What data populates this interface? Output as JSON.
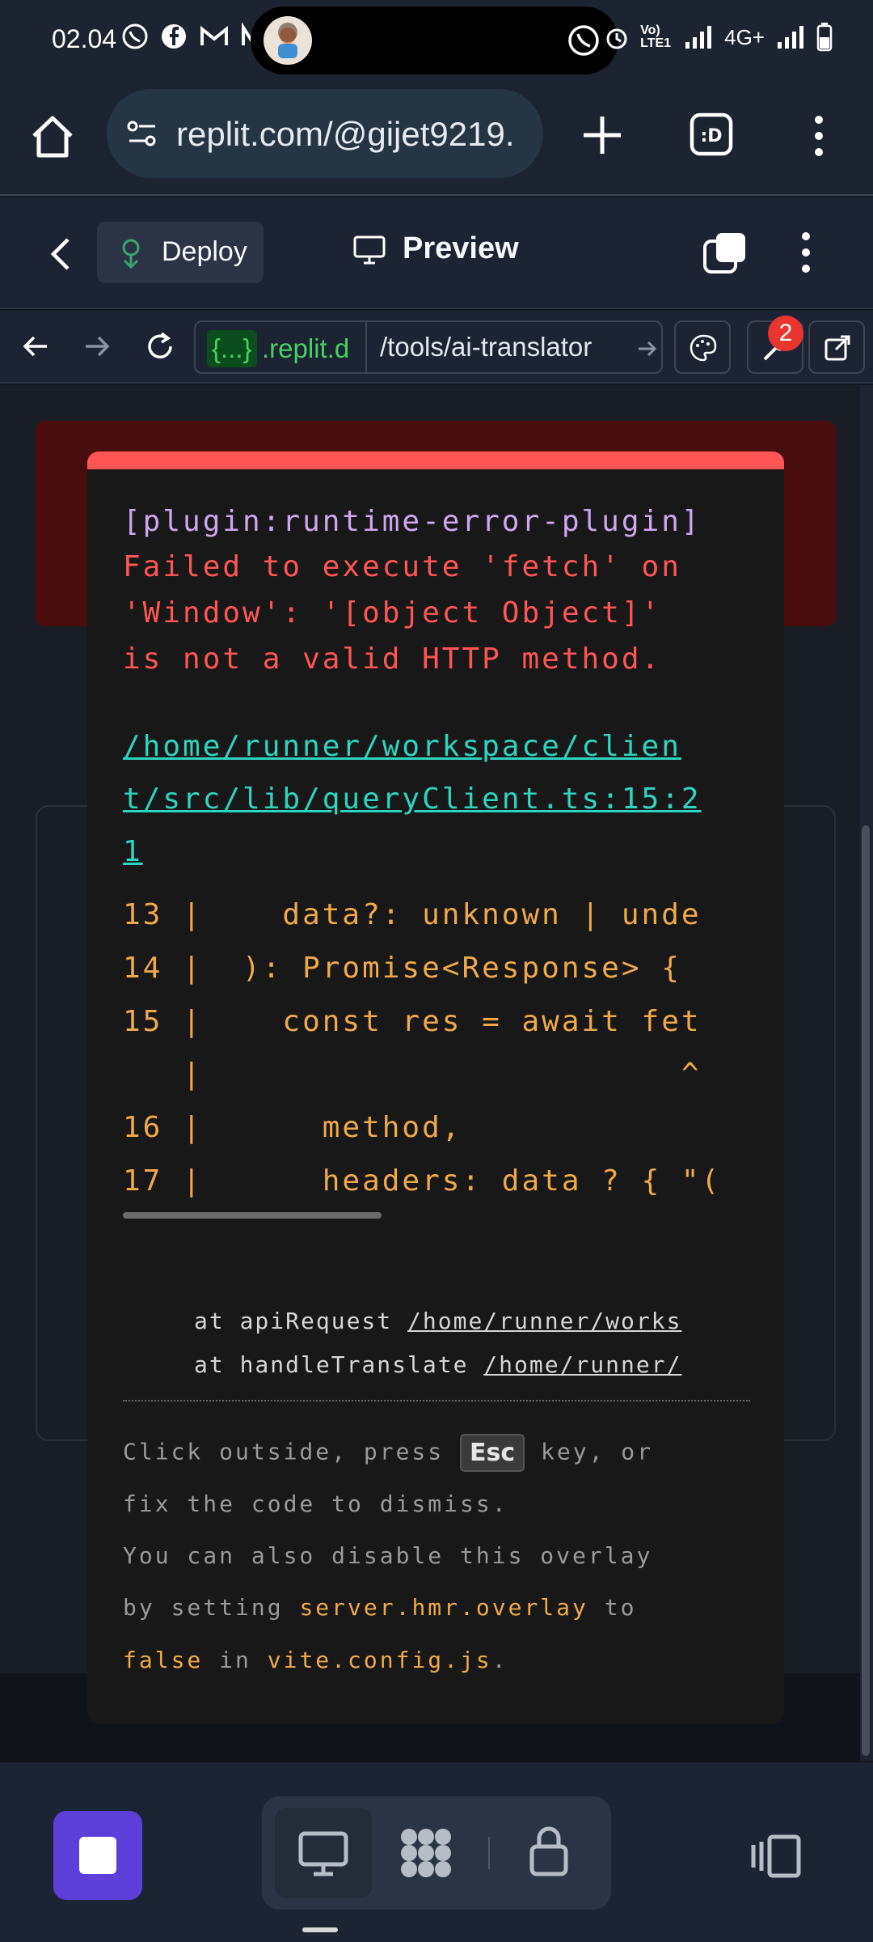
{
  "status_bar": {
    "time": "02.04",
    "network": "4G+",
    "volte": "Vo) LTE1"
  },
  "browser": {
    "url": "replit.com/@gijet9219."
  },
  "replit_header": {
    "deploy_label": "Deploy",
    "preview_label": "Preview"
  },
  "webview": {
    "host_badge": "{...}",
    "host_rest": ".replit.d",
    "path": "/tools/ai-translator",
    "notification_count": "2"
  },
  "error_overlay": {
    "plugin": "[plugin:runtime-error-plugin]",
    "message_lines": [
      "Failed to execute 'fetch' on",
      "'Window': '[object Object]'",
      "is not a valid HTTP method."
    ],
    "file_lines": [
      "/home/runner/workspace/clien",
      "t/src/lib/queryClient.ts:15:2",
      "1"
    ],
    "code_lines": [
      "13 |    data?: unknown | unde",
      "14 |  ): Promise<Response> {",
      "15 |    const res = await fet",
      "   |                        ^",
      "16 |      method,",
      "17 |      headers: data ? { \"("
    ],
    "stack": [
      {
        "prefix": "at apiRequest ",
        "link": "/home/runner/works"
      },
      {
        "prefix": "at handleTranslate ",
        "link": "/home/runner/"
      }
    ],
    "tip": {
      "line1_a": "Click outside, press ",
      "esc_key": "Esc",
      "line1_b": " key, or",
      "line2": "fix the code to dismiss.",
      "line3": "You can also disable this overlay",
      "line4_a": "by setting ",
      "line4_hl": "server.hmr.overlay",
      "line4_b": " to",
      "line5_hl": "false",
      "line5_a": " in ",
      "line5_hl2": "vite.config.js",
      "line5_b": "."
    }
  },
  "colors": {
    "overlay_accent": "#ff5555",
    "link": "#2dd4bf",
    "code": "#f0a94a",
    "stop_button": "#5b3fd8"
  }
}
